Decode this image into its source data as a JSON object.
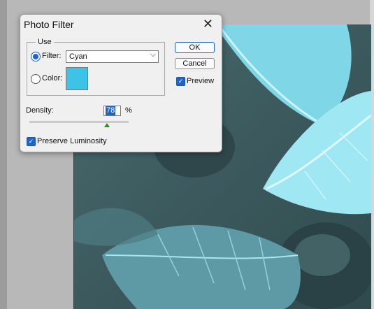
{
  "dialog": {
    "title": "Photo Filter",
    "use_label": "Use",
    "filter_label": "Filter:",
    "filter_value": "Cyan",
    "color_label": "Color:",
    "color_swatch": "#3cc3e6",
    "ok_label": "OK",
    "cancel_label": "Cancel",
    "preview_label": "Preview",
    "density_label": "Density:",
    "density_value": "78",
    "density_unit": "%",
    "density_fraction": 0.78,
    "preserve_label": "Preserve Luminosity"
  },
  "icons": {
    "close": "close-icon",
    "dropdown": "chevron-down-icon",
    "check": "checkmark-icon"
  },
  "colors": {
    "accent": "#1f64c8",
    "canvas": "#3f5f63",
    "leaf": "#7fe3f4"
  }
}
